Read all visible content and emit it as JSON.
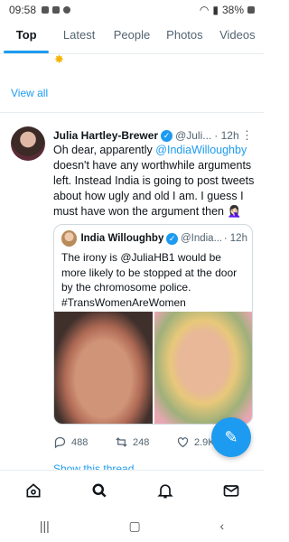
{
  "status": {
    "time": "09:58",
    "battery": "38%"
  },
  "tabs": [
    {
      "label": "Top",
      "active": true
    },
    {
      "label": "Latest"
    },
    {
      "label": "People"
    },
    {
      "label": "Photos"
    },
    {
      "label": "Videos"
    }
  ],
  "view_all": "View all",
  "tweet": {
    "name": "Julia Hartley-Brewer",
    "handle": "@Juli...",
    "time": "· 12h",
    "text_before": "Oh dear, apparently ",
    "mention": "@IndiaWilloughby",
    "text_after": " doesn't have any worthwhile arguments left. Instead India is going to post tweets about how ugly and old I am. I guess I must have won the argument then 🤦🏻‍♀️",
    "quote": {
      "name": "India Willoughby",
      "handle": "@India...",
      "time": "· 12h",
      "text": "The irony is @JuliaHB1 would be more likely to be stopped at the door by the chromosome police. #TransWomenAreWomen"
    },
    "actions": {
      "replies": "488",
      "retweets": "248",
      "likes": "2.9K"
    },
    "show_thread": "Show this thread"
  },
  "colors": {
    "accent": "#1d9bf0"
  }
}
